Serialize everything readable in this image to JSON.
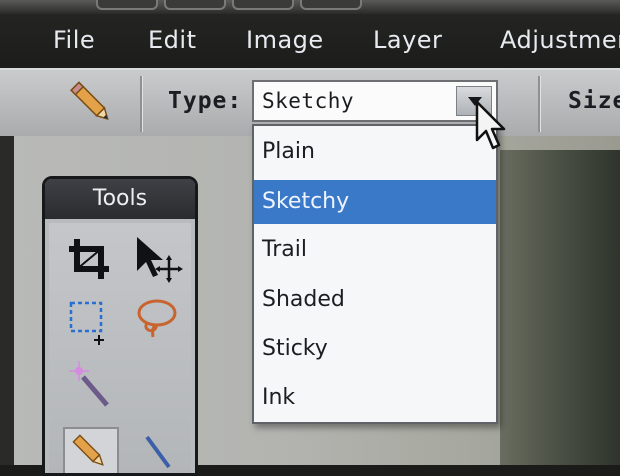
{
  "menu": {
    "items": [
      {
        "label": "File"
      },
      {
        "label": "Edit"
      },
      {
        "label": "Image"
      },
      {
        "label": "Layer"
      },
      {
        "label": "Adjustmen"
      }
    ]
  },
  "tool_options": {
    "active_tool_icon": "pencil-icon",
    "type_label": "Type:",
    "type_value": "Sketchy",
    "size_label": "Size"
  },
  "type_dropdown": {
    "open": true,
    "selected": "Sketchy",
    "options": [
      "Plain",
      "Sketchy",
      "Trail",
      "Shaded",
      "Sticky",
      "Ink"
    ]
  },
  "tools_panel": {
    "title": "Tools",
    "tool_icons": [
      "crop-icon",
      "move-icon",
      "marquee-select-icon",
      "lasso-icon",
      "magic-wand-icon",
      "pencil-icon",
      "brush-icon"
    ]
  },
  "colors": {
    "menubar": "#1f1f1e",
    "optionbar": "#bfc1c3",
    "selection": "#3a78c8",
    "menu_text": "#e7ebf0"
  }
}
